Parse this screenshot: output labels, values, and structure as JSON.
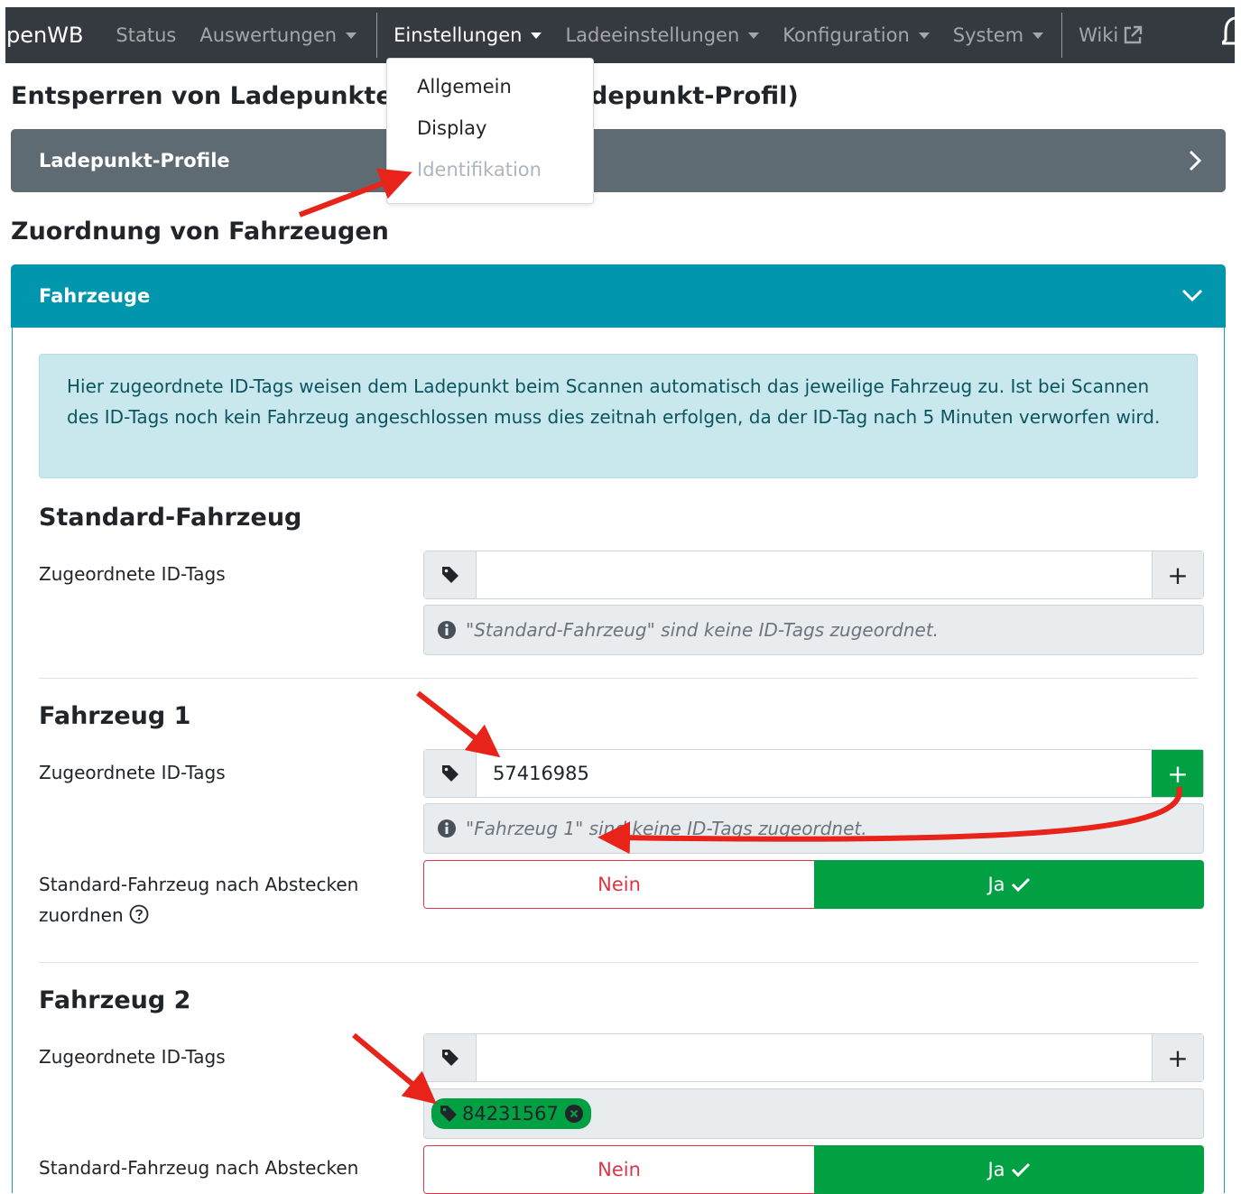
{
  "navbar": {
    "brand": "penWB",
    "items": [
      {
        "label": "Status"
      },
      {
        "label": "Auswertungen"
      },
      {
        "label": "Einstellungen"
      },
      {
        "label": "Ladeeinstellungen"
      },
      {
        "label": "Konfiguration"
      },
      {
        "label": "System"
      },
      {
        "label": "Wiki"
      }
    ]
  },
  "dropdown": {
    "items": [
      {
        "label": "Allgemein"
      },
      {
        "label": "Display"
      },
      {
        "label": "Identifikation"
      }
    ]
  },
  "section1": {
    "title_left": "Entsperren von Ladepunkten (",
    "title_right": "depunkt-Profil)",
    "card_title": "Ladepunkt-Profile"
  },
  "section2": {
    "title": "Zuordnung von Fahrzeugen",
    "card_title": "Fahrzeuge",
    "info_text": "Hier zugeordnete ID-Tags weisen dem Ladepunkt beim Scannen automatisch das jeweilige Fahrzeug zu. Ist bei Scannen des ID-Tags noch kein Fahrzeug angeschlossen muss dies zeitnah erfolgen, da der ID-Tag nach 5 Minuten verworfen wird."
  },
  "vehicles": [
    {
      "name": "Standard-Fahrzeug",
      "tags_label": "Zugeordnete ID-Tags",
      "input_value": "",
      "empty_text": "\"Standard-Fahrzeug\" sind keine ID-Tags zugeordnet."
    },
    {
      "name": "Fahrzeug 1",
      "tags_label": "Zugeordnete ID-Tags",
      "input_value": "57416985",
      "empty_text": "\"Fahrzeug 1\" sind keine ID-Tags zugeordnet.",
      "default_label_line1": "Standard-Fahrzeug nach Abstecken",
      "default_label_line2": "zuordnen",
      "no_label": "Nein",
      "yes_label": "Ja"
    },
    {
      "name": "Fahrzeug 2",
      "tags_label": "Zugeordnete ID-Tags",
      "input_value": "",
      "tag": "84231567",
      "default_label_line1": "Standard-Fahrzeug nach Abstecken",
      "no_label": "Nein",
      "yes_label": "Ja"
    }
  ],
  "colors": {
    "navbar": "#343a40",
    "secondary": "#5f6b73",
    "info": "#0096ad",
    "success": "#00a043",
    "danger": "#dc3545",
    "annotation": "#e8231a"
  }
}
